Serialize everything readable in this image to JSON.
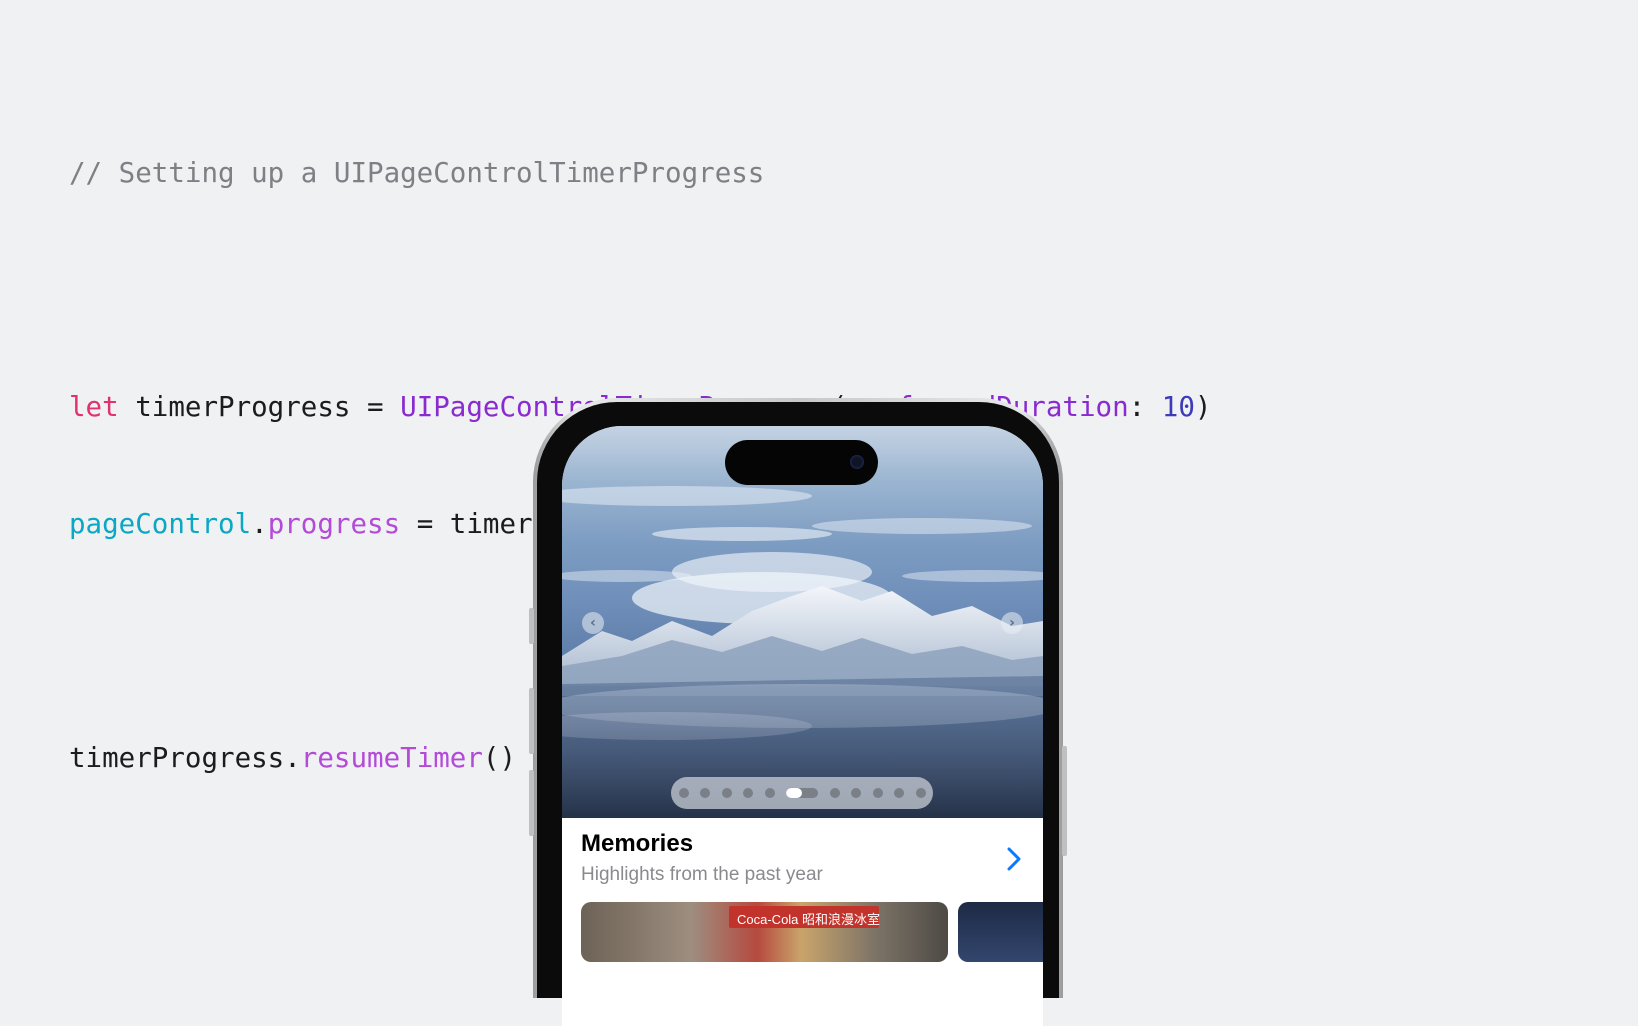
{
  "code": {
    "comment": "// Setting up a UIPageControlTimerProgress",
    "line1": {
      "keyword": "let",
      "variable": " timerProgress = ",
      "type": "UIPageControlTimerProgress",
      "open_paren": "(",
      "param": "preferredDuration",
      "colon": ": ",
      "number": "10",
      "close_paren": ")"
    },
    "line2": {
      "object": "pageControl",
      "dot": ".",
      "property": "progress",
      "rest": " = timerProgress"
    },
    "line3": {
      "object": "timerProgress.",
      "method": "resumeTimer",
      "call": "()"
    }
  },
  "phone": {
    "card": {
      "title": "Memories",
      "subtitle": "Highlights from the past year",
      "thumbnail_sign_text": "Coca-Cola 昭和浪漫冰室"
    },
    "page_control": {
      "page_count": 11,
      "current_page_index": 5,
      "timer_progress": 0.5
    },
    "icons": {
      "previous": "chevron-left-icon",
      "next": "chevron-right-icon",
      "disclosure": "chevron-right-icon"
    },
    "colors": {
      "accent": "#0a7aff",
      "keyword": "#e0336e",
      "type": "#8a2bd1",
      "number": "#3d3bb8",
      "property_cyan": "#0aa8c4",
      "method": "#b34ad8",
      "comment": "#7f7f85"
    }
  }
}
